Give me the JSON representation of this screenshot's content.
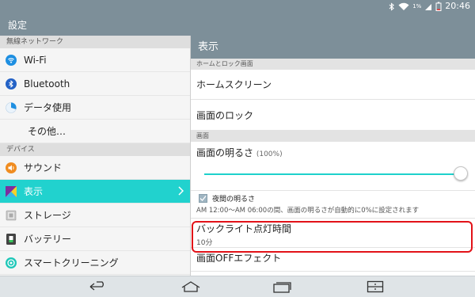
{
  "status_bar": {
    "time": "20:46",
    "battery_percent": "1%",
    "icons": [
      "bluetooth-icon",
      "wifi-icon",
      "signal-icon",
      "battery-icon"
    ]
  },
  "app_bar": {
    "title": "設定"
  },
  "left_panel": {
    "wireless_section": "無線ネットワーク",
    "wifi_label": "Wi-Fi",
    "bluetooth_label": "Bluetooth",
    "data_usage_label": "データ使用",
    "other_label": "その他…",
    "device_section": "デバイス",
    "sound_label": "サウンド",
    "display_label": "表示",
    "storage_label": "ストレージ",
    "battery_label": "バッテリー",
    "smart_clean_label": "スマートクリーニング"
  },
  "right_panel": {
    "header": "表示",
    "home_lock_section": "ホームとロック画面",
    "home_screen_label": "ホームスクリーン",
    "screen_lock_label": "画面のロック",
    "screen_section": "画面",
    "brightness_label": "画面の明るさ",
    "brightness_value": "(100%)",
    "brightness_level": 1.0,
    "night_brightness_label": "夜間の明るさ",
    "night_brightness_checked": true,
    "night_note": "AM 12:00〜AM 06:00の間、画面の明るさが自動的に0%に設定されます",
    "backlight_label": "バックライト点灯時間",
    "backlight_value": "10分",
    "off_effect_label": "画面OFFエフェクト"
  },
  "nav_bar": {
    "buttons": [
      "back-icon",
      "home-icon",
      "recent-apps-icon",
      "menu-icon"
    ]
  },
  "colors": {
    "accent": "#21d2ce",
    "bar": "#7d8f99",
    "highlight": "#e21218"
  }
}
